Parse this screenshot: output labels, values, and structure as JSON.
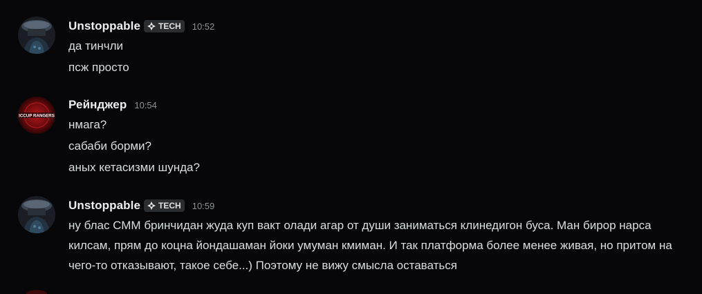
{
  "messages": [
    {
      "username": "Unstoppable",
      "tag": "TECH",
      "time": "10:52",
      "avatar_icon": "helmet-avatar",
      "lines": [
        "да тинчли",
        "псж просто"
      ]
    },
    {
      "username": "Рейнджер",
      "time": "10:54",
      "avatar_icon": "rangers-avatar",
      "avatar_text": "ICCUP RANGERS",
      "lines": [
        "нмага?",
        "сабаби борми?",
        "аных кетасизми шунда?"
      ]
    },
    {
      "username": "Unstoppable",
      "tag": "TECH",
      "time": "10:59",
      "avatar_icon": "helmet-avatar",
      "paragraph": "ну блас СММ бринчидан жуда куп вакт олади агар от души заниматься клинедигон буса. Ман бирор нарса килсам, прям до коцна йондашаман йоки умуман кмиман. И так платформа более менее живая, но притом на чего-то отказывают, такое себе...) Поэтому не вижу смысла оставаться"
    }
  ],
  "colors": {
    "background": "#070709",
    "text": "#dbdee1",
    "username": "#eeeff1",
    "timestamp": "#8e9297",
    "tag_bg": "#2b2d31"
  }
}
